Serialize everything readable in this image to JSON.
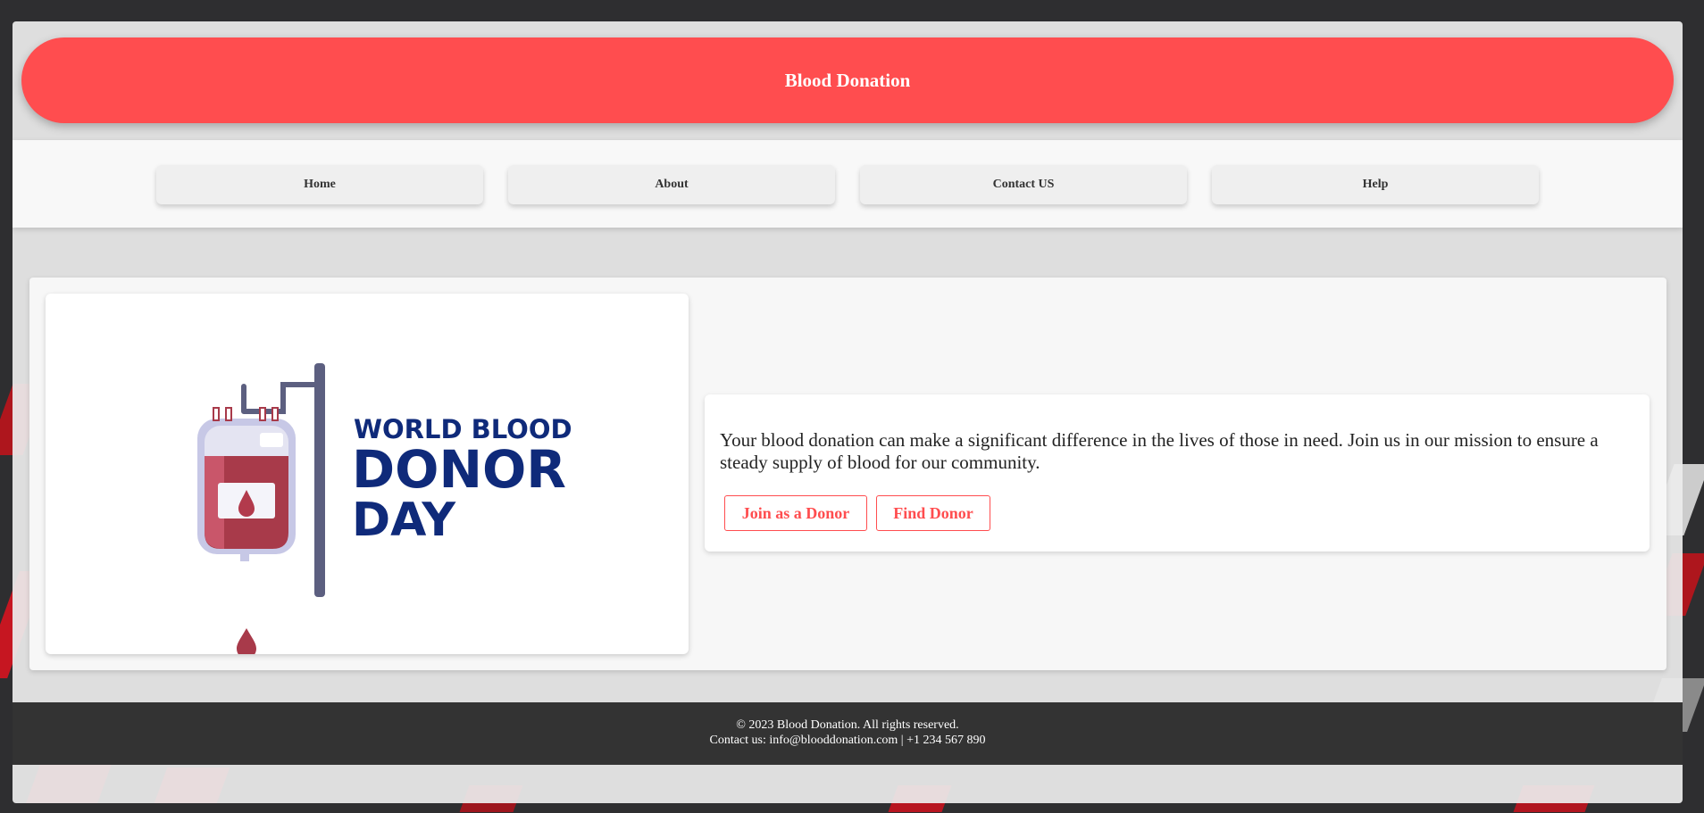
{
  "header": {
    "title": "Blood Donation"
  },
  "nav": {
    "items": [
      {
        "label": "Home"
      },
      {
        "label": "About"
      },
      {
        "label": "Contact US"
      },
      {
        "label": "Help"
      }
    ]
  },
  "hero": {
    "image": {
      "line1": "WORLD BLOOD",
      "line2": "DONOR",
      "line3": "DAY"
    },
    "description": "Your blood donation can make a significant difference in the lives of those in need. Join us in our mission to ensure a steady supply of blood for our community.",
    "join_label": "Join as a Donor",
    "find_label": "Find Donor"
  },
  "footer": {
    "copyright": "© 2023 Blood Donation. All rights reserved.",
    "contact": "Contact us: info@blooddonation.com | +1 234 567 890"
  },
  "colors": {
    "accent": "#ff4d4f",
    "footer_bg": "#333333",
    "navy": "#0f2a7a"
  }
}
